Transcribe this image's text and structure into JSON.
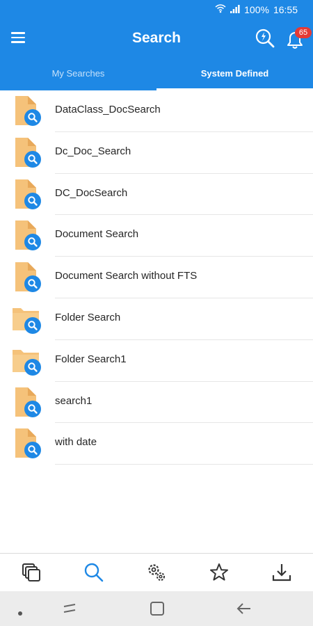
{
  "status_bar": {
    "battery": "100%",
    "time": "16:55",
    "icons": [
      "wifi-icon",
      "signal-icon"
    ]
  },
  "app_bar": {
    "title": "Search",
    "notification_count": "65",
    "icons": [
      "menu-icon",
      "search-action-icon",
      "bell-icon"
    ]
  },
  "tabs": [
    {
      "label": "My Searches",
      "active": false
    },
    {
      "label": "System Defined",
      "active": true
    }
  ],
  "searches": [
    {
      "label": "DataClass_DocSearch",
      "icon": "document-search-icon"
    },
    {
      "label": "Dc_Doc_Search",
      "icon": "document-search-icon"
    },
    {
      "label": "DC_DocSearch",
      "icon": "document-search-icon"
    },
    {
      "label": "Document Search",
      "icon": "document-search-icon"
    },
    {
      "label": "Document Search without FTS",
      "icon": "document-search-icon"
    },
    {
      "label": "Folder Search",
      "icon": "folder-search-icon"
    },
    {
      "label": "Folder Search1",
      "icon": "folder-search-icon"
    },
    {
      "label": "search1",
      "icon": "document-search-icon"
    },
    {
      "label": "with date",
      "icon": "document-search-icon"
    }
  ],
  "bottom_nav": [
    {
      "name": "documents",
      "icon": "documents-icon",
      "active": false
    },
    {
      "name": "search",
      "icon": "search-icon",
      "active": true
    },
    {
      "name": "settings",
      "icon": "settings-icon",
      "active": false
    },
    {
      "name": "favorites",
      "icon": "star-icon",
      "active": false
    },
    {
      "name": "downloads",
      "icon": "download-icon",
      "active": false
    }
  ],
  "colors": {
    "primary": "#1e88e5",
    "badge": "#e53935",
    "file": "#f5c27a",
    "active_nav": "#1e88e5"
  }
}
